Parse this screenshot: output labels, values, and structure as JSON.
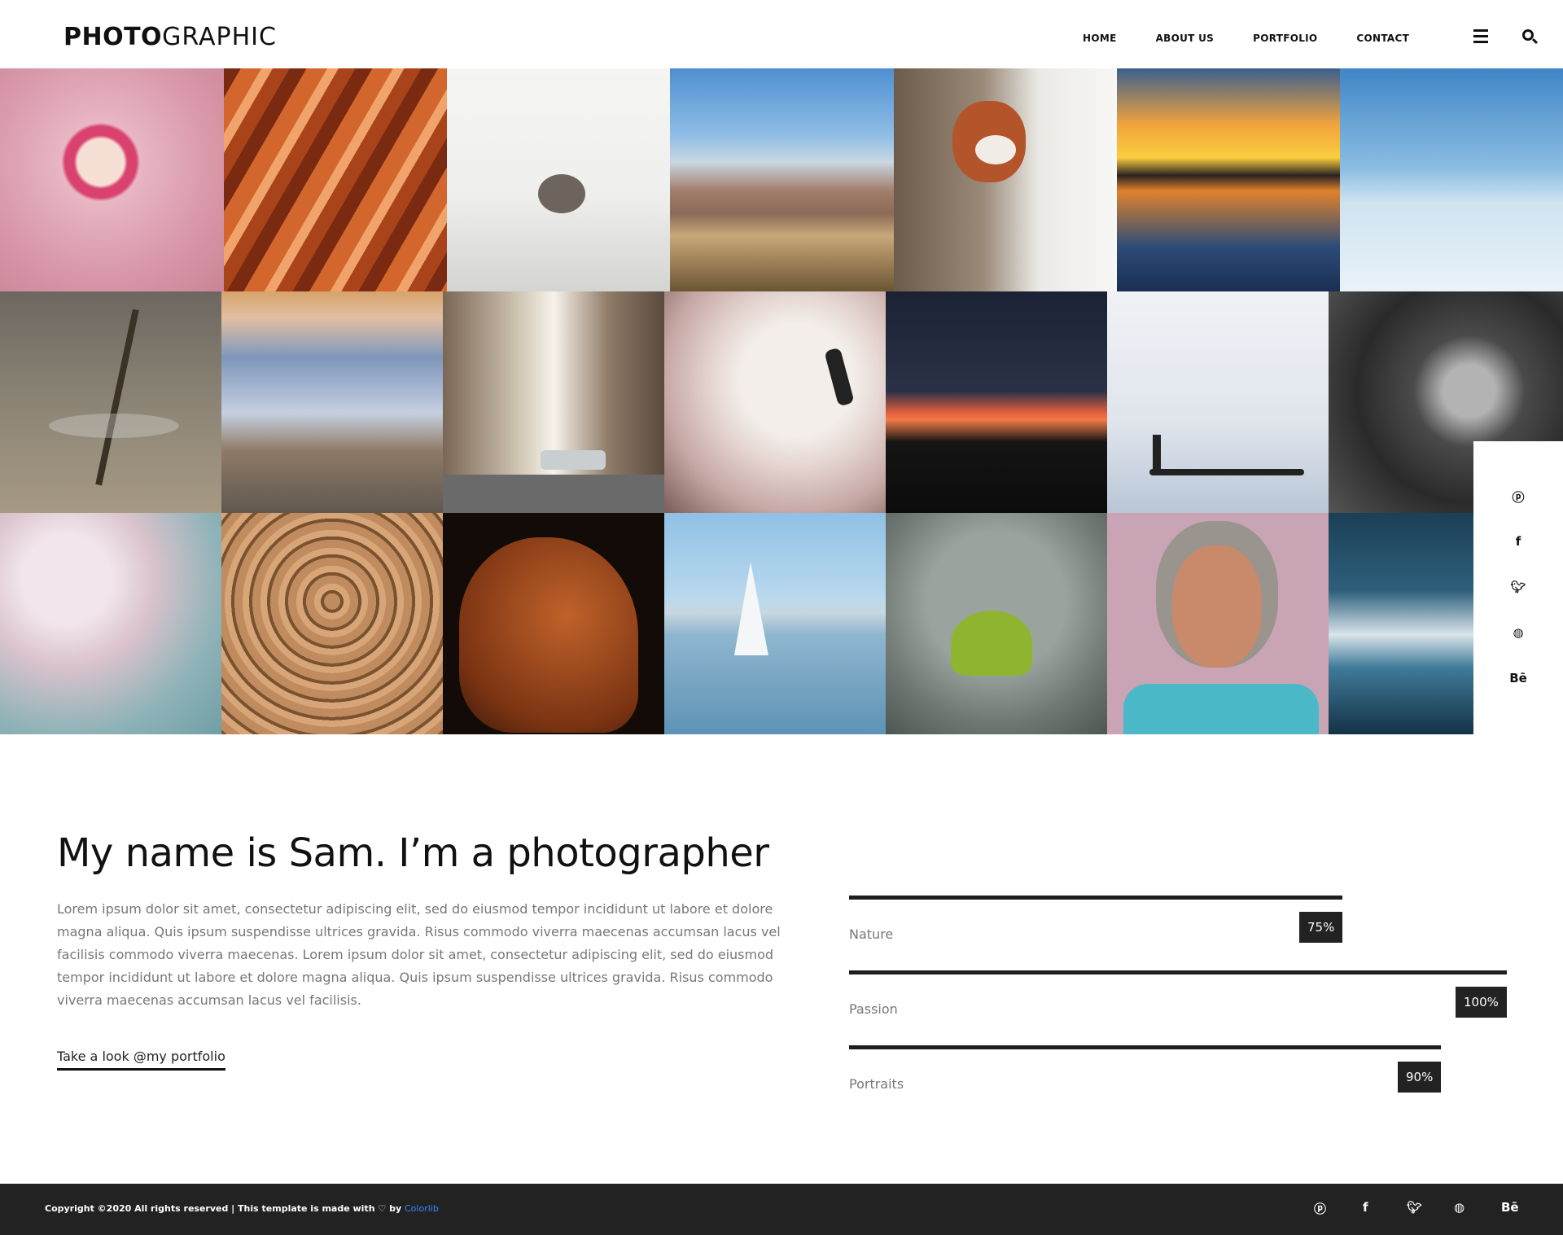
{
  "header": {
    "logo_bold": "PHOTO",
    "logo_light": "GRAPHIC",
    "nav": [
      "HOME",
      "ABOUT US",
      "PORTFOLIO",
      "CONTACT"
    ]
  },
  "gallery": {
    "rows": [
      [
        "flamingo-closeup",
        "sandstone-canyon",
        "small-bird",
        "desert-mountains",
        "red-panda",
        "yoga-sunset-reflection",
        "snowy-mountains"
      ],
      [
        "dragonfly",
        "road-above-clouds",
        "city-street-classic-car",
        "flamingos",
        "night-sky-sunset",
        "fisherman-boat-mist",
        "girl-black-and-white"
      ],
      [
        "dandelion-flower",
        "rope-coil",
        "brown-dog",
        "sailboat",
        "ginkgo-leaf-buddha",
        "elderly-woman-portrait",
        "ocean-waves"
      ]
    ]
  },
  "side_social": [
    "pinterest-icon",
    "facebook-icon",
    "twitter-icon",
    "dribbble-icon",
    "behance-icon"
  ],
  "about": {
    "title": "My name is Sam. I’m a photographer",
    "text": "Lorem ipsum dolor sit amet, consectetur adipiscing elit, sed do eiusmod tempor incididunt ut labore et dolore magna aliqua. Quis ipsum suspendisse ultrices gravida. Risus commodo viverra maecenas accumsan lacus vel facilisis commodo viverra maecenas. Lorem ipsum dolor sit amet, consectetur adipiscing elit, sed do eiusmod tempor incididunt ut labore et dolore magna aliqua. Quis ipsum suspendisse ultrices gravida. Risus commodo viverra maecenas accumsan lacus vel facilisis.",
    "link": "Take a look @my portfolio"
  },
  "skills": [
    {
      "label": "Nature",
      "percent": 75,
      "percent_text": "75%"
    },
    {
      "label": "Passion",
      "percent": 100,
      "percent_text": "100%"
    },
    {
      "label": "Portraits",
      "percent": 90,
      "percent_text": "90%"
    }
  ],
  "footer": {
    "copyright": "Copyright ©2020 All rights reserved | This template is made with",
    "heart": "♡",
    "by": "by",
    "brand": "Colorlib"
  }
}
